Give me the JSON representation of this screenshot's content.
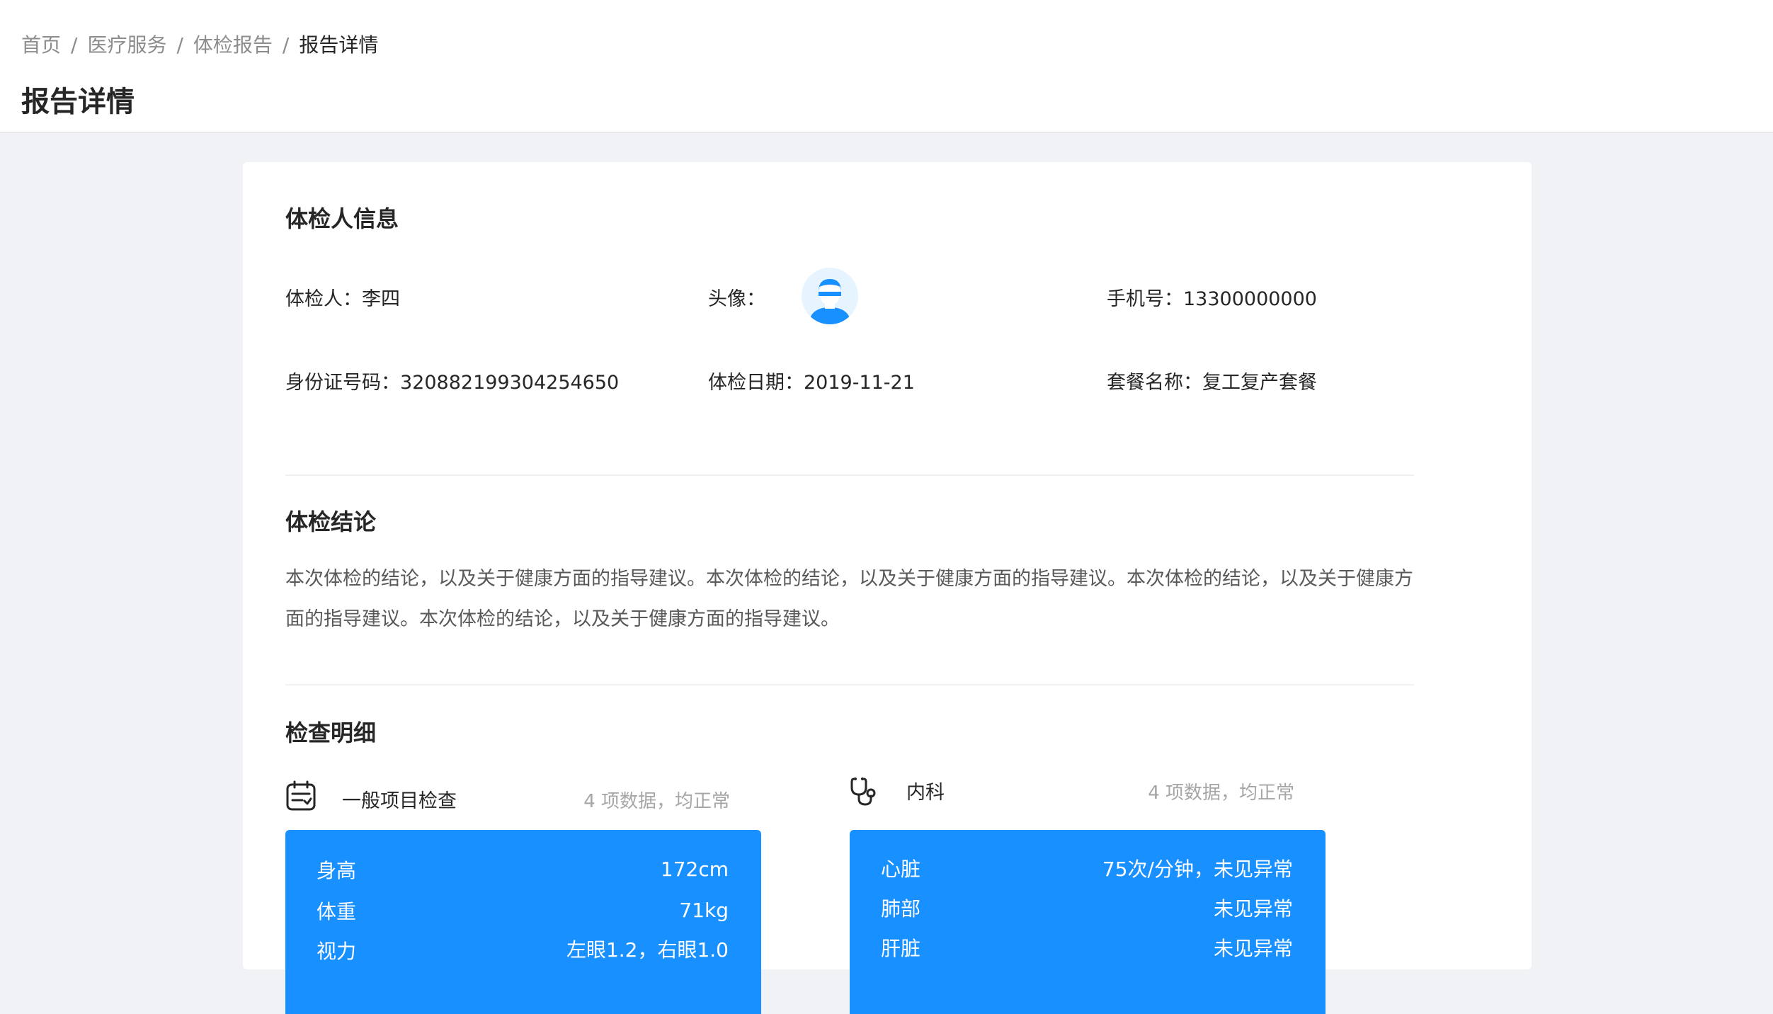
{
  "breadcrumb": [
    "首页",
    "医疗服务",
    "体检报告",
    "报告详情"
  ],
  "page_title": "报告详情",
  "person_section": {
    "title": "体检人信息",
    "name_label": "体检人：",
    "name": "李四",
    "avatar_label": "头像：",
    "phone_label": "手机号：",
    "phone": "13300000000",
    "id_label": "身份证号码：",
    "id_number": "320882199304254650",
    "date_label": "体检日期：",
    "date": "2019-11-21",
    "package_label": "套餐名称：",
    "package": "复工复产套餐"
  },
  "conclusion_section": {
    "title": "体检结论",
    "text": "本次体检的结论，以及关于健康方面的指导建议。本次体检的结论，以及关于健康方面的指导建议。本次体检的结论，以及关于健康方面的指导建议。本次体检的结论，以及关于健康方面的指导建议。"
  },
  "detail_section": {
    "title": "检查明细",
    "groups": [
      {
        "icon": "checklist-icon",
        "name": "一般项目检查",
        "summary": "4 项数据，均正常",
        "items": [
          {
            "key": "身高",
            "value": "172cm"
          },
          {
            "key": "体重",
            "value": "71kg"
          },
          {
            "key": "视力",
            "value": "左眼1.2，右眼1.0"
          }
        ]
      },
      {
        "icon": "stethoscope-icon",
        "name": "内科",
        "summary": "4 项数据，均正常",
        "items": [
          {
            "key": "心脏",
            "value": "75次/分钟，未见异常"
          },
          {
            "key": "肺部",
            "value": "未见异常"
          },
          {
            "key": "肝脏",
            "value": "未见异常"
          }
        ]
      }
    ]
  },
  "colors": {
    "accent": "#1890ff",
    "background": "#f0f2f5",
    "avatar_bg": "#e6f4ff"
  }
}
